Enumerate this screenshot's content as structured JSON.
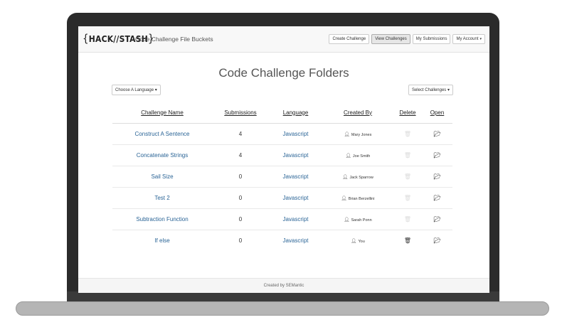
{
  "navbar": {
    "logo_left": "{",
    "logo_text": "HACK//STASH",
    "logo_right": "}",
    "title": "Code Challenge File Buckets",
    "buttons": [
      {
        "label": "Create Challenge"
      },
      {
        "label": "View Challenges",
        "active": true
      },
      {
        "label": "My Submissions"
      },
      {
        "label": "My Account",
        "caret": "▾"
      }
    ]
  },
  "page": {
    "title": "Code Challenge Folders",
    "language_dropdown": "Choose A Language",
    "challenges_dropdown": "Select Challenges",
    "caret": "▾"
  },
  "table": {
    "headers": [
      "Challenge Name",
      "Submissions",
      "Language",
      "Created By",
      "Delete",
      "Open"
    ],
    "rows": [
      {
        "name": "Construct A Sentence",
        "submissions": "4",
        "language": "Javascript",
        "created_by": "Mary Jones",
        "delete_enabled": false
      },
      {
        "name": "Concatenate Strings",
        "submissions": "4",
        "language": "Javascript",
        "created_by": "Joe Smith",
        "delete_enabled": false
      },
      {
        "name": "Sail Size",
        "submissions": "0",
        "language": "Javascript",
        "created_by": "Jack Sparrow",
        "delete_enabled": false
      },
      {
        "name": "Test 2",
        "submissions": "0",
        "language": "Javascript",
        "created_by": "Brian Berzellini",
        "delete_enabled": false
      },
      {
        "name": "Subtraction Function",
        "submissions": "0",
        "language": "Javascript",
        "created_by": "Sarah Ponn",
        "delete_enabled": false
      },
      {
        "name": "If else",
        "submissions": "0",
        "language": "Javascript",
        "created_by": "You",
        "delete_enabled": true
      }
    ],
    "icons": {
      "user": "user-icon",
      "delete": "trash-icon",
      "open": "folder-open-icon"
    }
  },
  "footer": {
    "text": "Created by SEMantic"
  },
  "colors": {
    "link": "#2a6496",
    "navbar_bg": "#f8f8f8",
    "frame": "#2b2b2b"
  }
}
